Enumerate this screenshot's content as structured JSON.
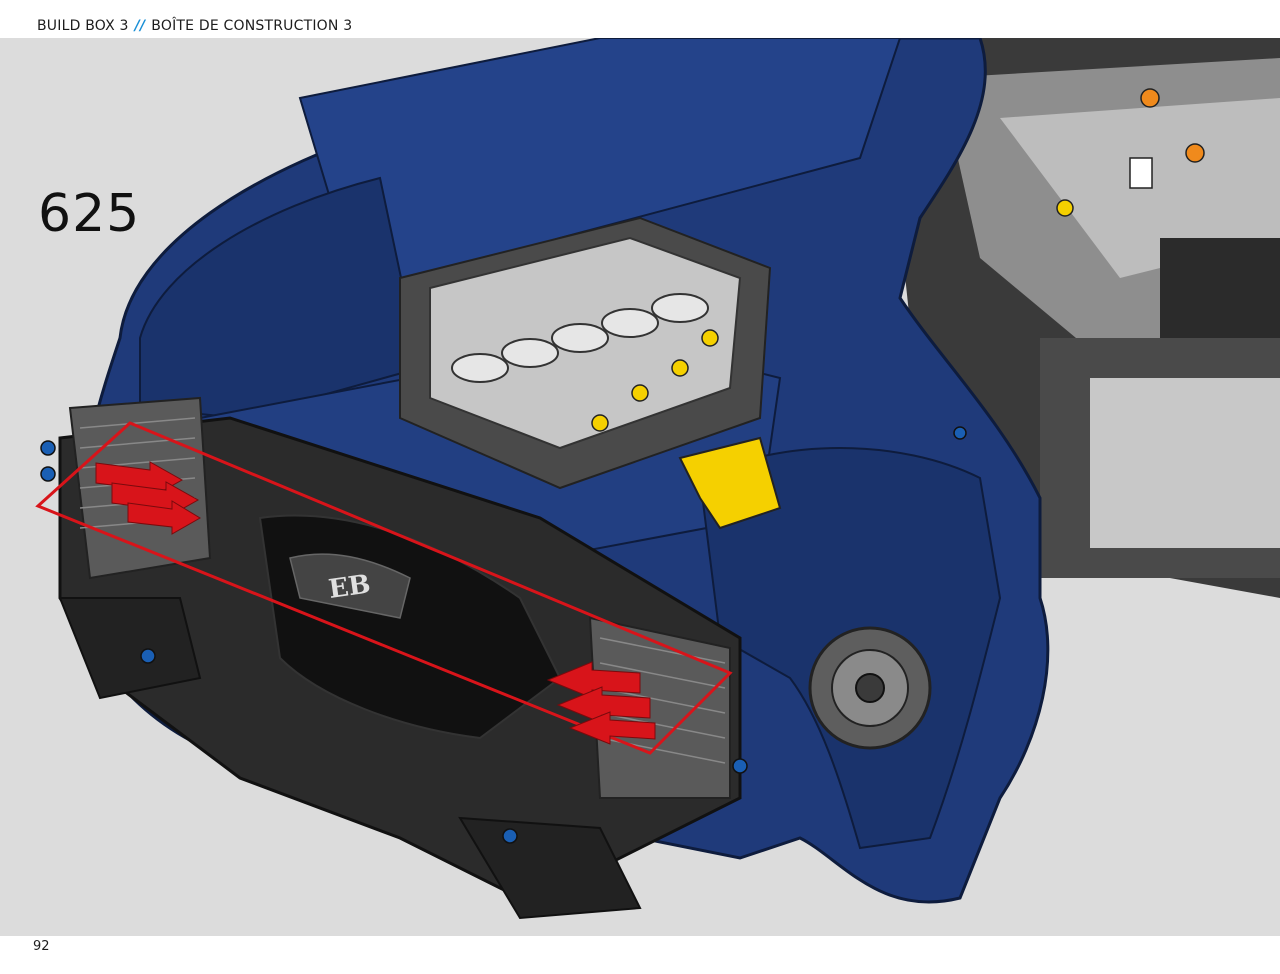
{
  "header": {
    "left_label": "BUILD BOX 3",
    "separator": "//",
    "right_label": "BOÎTE DE CONSTRUCTION 3"
  },
  "step": {
    "number": "625"
  },
  "footer": {
    "page_number": "92"
  },
  "illustration": {
    "subject": "model-car-front-assembly",
    "colors": {
      "background": "#dcdcdc",
      "body_blue": "#1f3a7a",
      "body_blue_dark": "#152a5c",
      "frame_dark": "#2b2b2b",
      "frame_light": "#bfbfbf",
      "highlight_red": "#d8141a",
      "accent_yellow": "#f5d000",
      "accent_orange": "#f08a1c",
      "header_separator": "#1a8fd6"
    },
    "callouts": [
      {
        "name": "insert-arrows-left",
        "color": "#d8141a"
      },
      {
        "name": "insert-arrows-right",
        "color": "#d8141a"
      }
    ]
  }
}
